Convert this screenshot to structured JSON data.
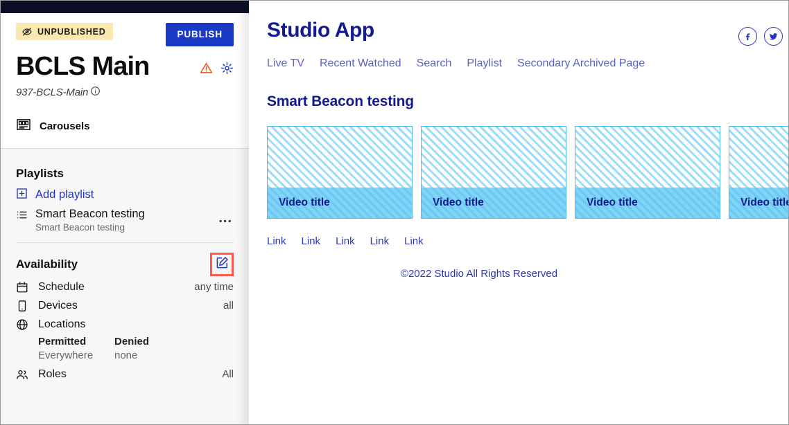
{
  "sidebar": {
    "status_badge": {
      "label": "UNPUBLISHED",
      "icon": "eye-slash-icon",
      "bg": "#fae8b0"
    },
    "publish_button": {
      "label": "PUBLISH",
      "bg": "#1a39c4"
    },
    "page_title": "BCLS Main",
    "title_icons": [
      {
        "name": "warning-icon",
        "color": "#e8521e"
      },
      {
        "name": "gear-icon",
        "color": "#1a39c4"
      }
    ],
    "subtitle": "937-BCLS-Main",
    "subtitle_info_icon": "info-icon",
    "carousels": {
      "label": "Carousels",
      "icon": "carousel-icon"
    },
    "playlists": {
      "heading": "Playlists",
      "add_label": "Add playlist",
      "add_icon": "plus-box-icon",
      "items": [
        {
          "icon": "list-icon",
          "name": "Smart Beacon testing",
          "subtitle": "Smart Beacon testing",
          "menu": "..."
        }
      ]
    },
    "availability": {
      "heading": "Availability",
      "edit_icon": "edit-pencil-icon",
      "edit_highlight_color": "#ff5a4d",
      "rows": [
        {
          "icon": "calendar-icon",
          "label": "Schedule",
          "value": "any time"
        },
        {
          "icon": "device-icon",
          "label": "Devices",
          "value": "all"
        },
        {
          "icon": "globe-icon",
          "label": "Locations",
          "value": ""
        }
      ],
      "locations": {
        "permitted_header": "Permitted",
        "permitted_value": "Everywhere",
        "denied_header": "Denied",
        "denied_value": "none"
      },
      "roles": {
        "icon": "people-icon",
        "label": "Roles",
        "value": "All"
      }
    }
  },
  "preview": {
    "app_title": "Studio App",
    "brand_color": "#131a8f",
    "socials": [
      {
        "name": "facebook-icon",
        "glyph": "f"
      },
      {
        "name": "twitter-icon",
        "glyph": "t"
      }
    ],
    "nav": [
      "Live TV",
      "Recent Watched",
      "Search",
      "Playlist",
      "Secondary Archived Page"
    ],
    "section_title": "Smart Beacon testing",
    "cards": [
      {
        "title": "Video title"
      },
      {
        "title": "Video title"
      },
      {
        "title": "Video title"
      },
      {
        "title": "Video title"
      }
    ],
    "footer_links": [
      "Link",
      "Link",
      "Link",
      "Link",
      "Link"
    ],
    "copyright": "©2022 Studio All Rights Reserved"
  }
}
